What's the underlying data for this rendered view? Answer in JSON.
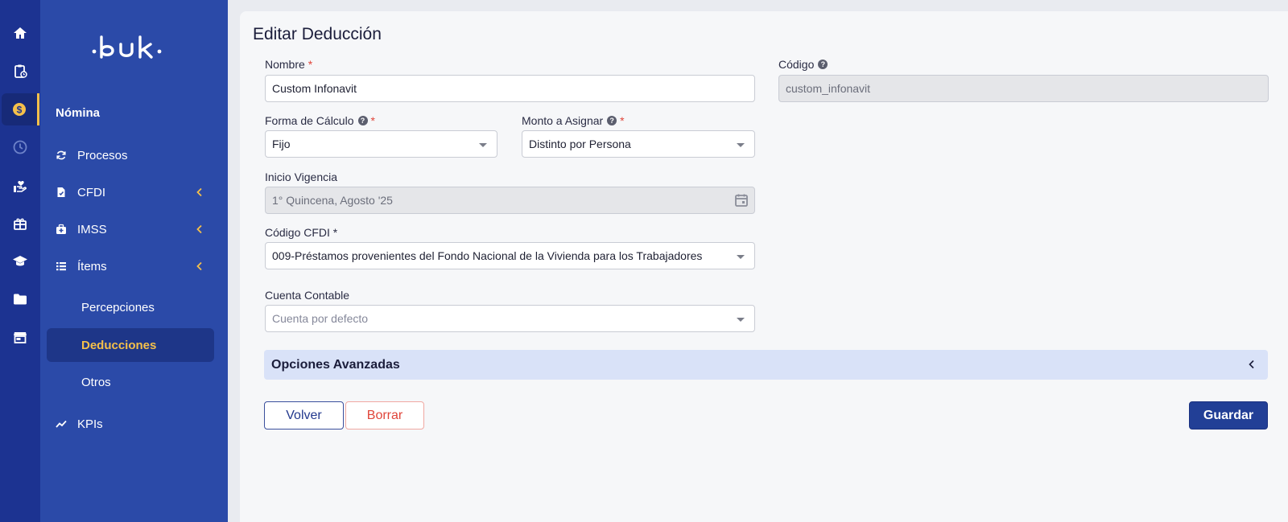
{
  "app": {
    "logo_text": "·buk·"
  },
  "rail": {
    "icons": [
      "home-icon",
      "clipboard-clock-icon",
      "dollar-icon",
      "clock-icon",
      "hand-heart-icon",
      "gift-icon",
      "graduation-cap-icon",
      "folder-icon",
      "store-icon"
    ],
    "active": "dollar-icon"
  },
  "sidebar": {
    "section": "Nómina",
    "items": [
      {
        "label": "Procesos",
        "icon": "refresh-icon"
      },
      {
        "label": "CFDI",
        "icon": "file-icon"
      },
      {
        "label": "IMSS",
        "icon": "medical-kit-icon"
      },
      {
        "label": "Ítems",
        "icon": "list-icon"
      }
    ],
    "subitems": [
      {
        "label": "Percepciones"
      },
      {
        "label": "Deducciones"
      },
      {
        "label": "Otros"
      }
    ],
    "kpis": {
      "label": "KPIs",
      "icon": "trend-icon"
    },
    "accent_color": "#f5c04a"
  },
  "form": {
    "title": "Editar Deducción",
    "nombre": {
      "label": "Nombre",
      "required": "*",
      "value": "Custom Infonavit"
    },
    "codigo": {
      "label": "Código",
      "value": "custom_infonavit"
    },
    "forma_calculo": {
      "label": "Forma de Cálculo",
      "required": "*",
      "value": "Fijo"
    },
    "monto_asignar": {
      "label": "Monto a Asignar",
      "required": "*",
      "value": "Distinto por Persona"
    },
    "inicio_vigencia": {
      "label": "Inicio Vigencia",
      "value": "1° Quincena, Agosto '25"
    },
    "codigo_cfdi": {
      "label": "Código CFDI *",
      "value": "009-Préstamos provenientes del Fondo Nacional de la Vivienda para los Trabajadores"
    },
    "cuenta_contable": {
      "label": "Cuenta Contable",
      "placeholder": "Cuenta por defecto"
    },
    "advanced": "Opciones Avanzadas",
    "buttons": {
      "back": "Volver",
      "delete": "Borrar",
      "save": "Guardar"
    },
    "help_glyph": "?"
  }
}
